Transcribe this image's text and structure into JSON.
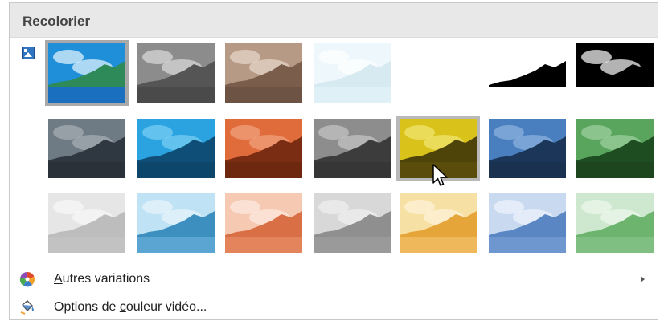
{
  "panel": {
    "title": "Recolorier"
  },
  "swatches": {
    "row1": [
      {
        "name": "no-recolor",
        "sky": "#1e8fd8",
        "land": "#2f8a5a",
        "water": "#1a6fbf",
        "cloud": "#e8f6ff"
      },
      {
        "name": "grayscale",
        "sky": "#8c8c8c",
        "land": "#555555",
        "water": "#4a4a4a",
        "cloud": "#dcdcdc"
      },
      {
        "name": "sepia",
        "sky": "#b69a86",
        "land": "#7a5d4b",
        "water": "#6d5343",
        "cloud": "#ead8ca"
      },
      {
        "name": "washout",
        "sky": "#eef7fb",
        "land": "#d8eaf1",
        "water": "#dff0f6",
        "cloud": "#ffffff"
      },
      {
        "name": "black-white-25",
        "sky": "#ffffff",
        "land": "#ffffff",
        "water": "#ffffff",
        "cloud": "#ffffff"
      },
      {
        "name": "black-white-50",
        "sky": "#ffffff",
        "land": "#000000",
        "water": "#ffffff",
        "cloud": "#ffffff"
      },
      {
        "name": "black-white-75",
        "sky": "#000000",
        "land": "#000000",
        "water": "#ffffff",
        "cloud": "#ffffff"
      }
    ],
    "row2": [
      {
        "name": "dark-gray",
        "sky": "#6f7b84",
        "land": "#2f3840",
        "water": "#2b3138",
        "cloud": "#a8b0b6"
      },
      {
        "name": "dark-blue",
        "sky": "#2aa3e0",
        "land": "#0f4f77",
        "water": "#0c476b",
        "cloud": "#7dd0f3"
      },
      {
        "name": "dark-orange",
        "sky": "#e06c3c",
        "land": "#7a2d12",
        "water": "#6e2810",
        "cloud": "#f2a47f"
      },
      {
        "name": "dark-gray-2",
        "sky": "#8d8d8d",
        "land": "#3c3c3c",
        "water": "#363636",
        "cloud": "#c6c6c6"
      },
      {
        "name": "dark-gold",
        "sky": "#d9c21a",
        "land": "#4e4308",
        "water": "#5a4c0b",
        "cloud": "#f1e675"
      },
      {
        "name": "dark-steel-blue",
        "sky": "#4a7fbf",
        "land": "#1b3658",
        "water": "#1a3150",
        "cloud": "#8fb3df"
      },
      {
        "name": "dark-green",
        "sky": "#5aa55e",
        "land": "#1f4d22",
        "water": "#1d461f",
        "cloud": "#9fd1a1"
      }
    ],
    "row3": [
      {
        "name": "light-gray",
        "sky": "#e6e6e6",
        "land": "#bdbdbd",
        "water": "#c2c2c2",
        "cloud": "#f8f8f8"
      },
      {
        "name": "light-blue",
        "sky": "#bfe2f4",
        "land": "#3d8fbf",
        "water": "#5aa5d1",
        "cloud": "#eaf6fc"
      },
      {
        "name": "light-orange",
        "sky": "#f6c9b3",
        "land": "#d96f45",
        "water": "#e3845c",
        "cloud": "#fcebe2"
      },
      {
        "name": "light-gray-2",
        "sky": "#d8d8d8",
        "land": "#8f8f8f",
        "water": "#9a9a9a",
        "cloud": "#f1f1f1"
      },
      {
        "name": "light-gold",
        "sky": "#f7e0a3",
        "land": "#e6a538",
        "water": "#efb85a",
        "cloud": "#fdf4dc"
      },
      {
        "name": "light-steel-blue",
        "sky": "#c9daf0",
        "land": "#5a86c3",
        "water": "#6f97cf",
        "cloud": "#eef4fb"
      },
      {
        "name": "light-green",
        "sky": "#cde8ce",
        "land": "#6db56f",
        "water": "#7fbf81",
        "cloud": "#eef8ee"
      }
    ]
  },
  "menu": {
    "more_variations": {
      "label_pre": "",
      "label_mnemonic": "A",
      "label_post": "utres variations",
      "icon": "palette-icon"
    },
    "video_color_options": {
      "label_pre": "Options de ",
      "label_mnemonic": "c",
      "label_post": "ouleur vidéo...",
      "icon": "paint-bucket-icon"
    }
  },
  "colors": {
    "header_bg": "#e8e8e8",
    "selection_border": "#a9a9a9"
  }
}
